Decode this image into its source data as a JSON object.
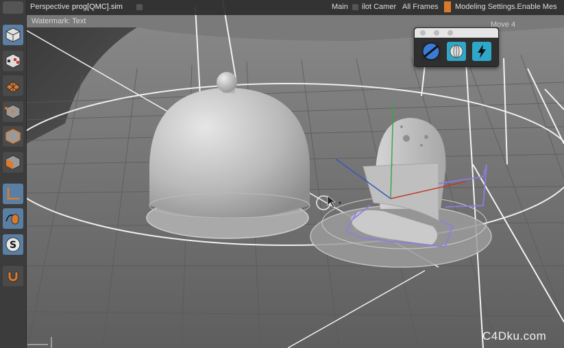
{
  "topbar": {
    "view_name": "Perspective",
    "file_name": "prog[QMC].sim",
    "view_menu": "Main",
    "camera_menu": "ilot Camer",
    "frames_label": "All Frames",
    "modeling_label": "Modeling Settings.Enable Mes"
  },
  "watermark_text": "Watermark: Text",
  "float_panel": {
    "tool_icons": [
      "sphere-tool-icon",
      "deformer-tool-icon",
      "bolt-tool-icon"
    ]
  },
  "mode_readout": "Move 4",
  "site_watermark": "C4Dku.com",
  "toolbar": {
    "tools": [
      {
        "name": "model-mode",
        "active": true
      },
      {
        "name": "texture-mode",
        "active": false
      },
      {
        "name": "workplane-mode",
        "active": false
      },
      {
        "name": "points-mode",
        "active": false
      },
      {
        "name": "edges-mode",
        "active": false
      },
      {
        "name": "polygons-mode",
        "active": false
      },
      {
        "name": "axis-mode",
        "active": true
      },
      {
        "name": "tweak-mode",
        "active": true
      },
      {
        "name": "snap-mode",
        "active": true
      },
      {
        "name": "magnet-tool",
        "active": false
      }
    ]
  },
  "colors": {
    "accent": "#5a7fa3",
    "selection": "#8a7fe0",
    "panel": "#3c3c3c"
  }
}
